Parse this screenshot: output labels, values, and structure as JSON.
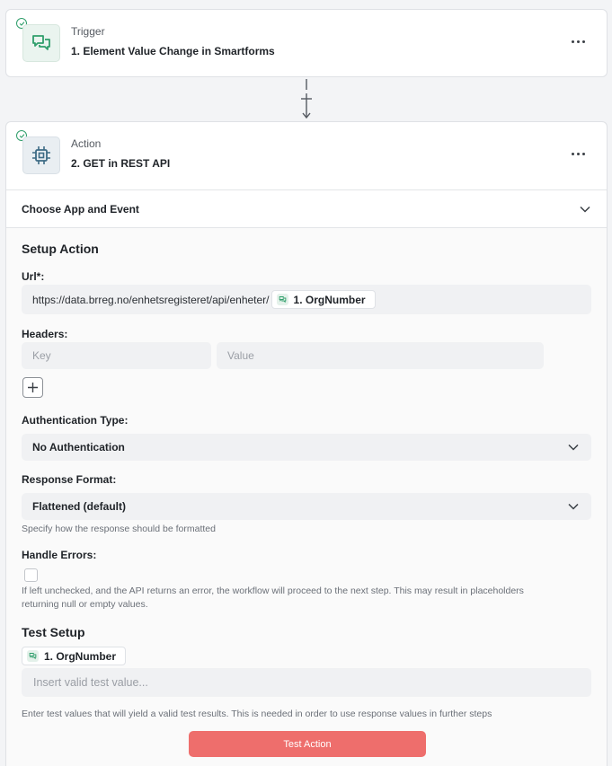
{
  "trigger": {
    "kind": "Trigger",
    "title": "1. Element Value Change in Smartforms",
    "status_icon": "check-circle-icon",
    "app_icon": "chat-bubbles-icon"
  },
  "action": {
    "kind": "Action",
    "title": "2. GET in REST API",
    "status_icon": "check-circle-icon",
    "app_icon": "chip-icon",
    "choose_app_label": "Choose App and Event",
    "setup_heading": "Setup Action",
    "url": {
      "label": "Url*:",
      "prefix": "https://data.brreg.no/enhetsregisteret/api/enheter/",
      "token": "1. OrgNumber"
    },
    "headers": {
      "label": "Headers:",
      "key_placeholder": "Key",
      "value_placeholder": "Value"
    },
    "auth": {
      "label": "Authentication Type:",
      "selected": "No Authentication"
    },
    "response_format": {
      "label": "Response Format:",
      "selected": "Flattened (default)",
      "helper": "Specify how the response should be formatted"
    },
    "handle_errors": {
      "label": "Handle Errors:",
      "checked": false,
      "helper_line1": "If left unchecked, and the API returns an error, the workflow will proceed to the next step. This may result in placeholders",
      "helper_line2": "returning null or empty values."
    },
    "test_setup": {
      "heading": "Test Setup",
      "token": "1. OrgNumber",
      "input_placeholder": "Insert valid test value...",
      "helper": "Enter test values that will yield a valid test results. This is needed in order to use response values in further steps",
      "button_label": "Test Action"
    }
  },
  "colors": {
    "accent_green": "#2f9e6b",
    "test_button": "#ee6e6c",
    "field_bg": "#f0f1f3"
  }
}
